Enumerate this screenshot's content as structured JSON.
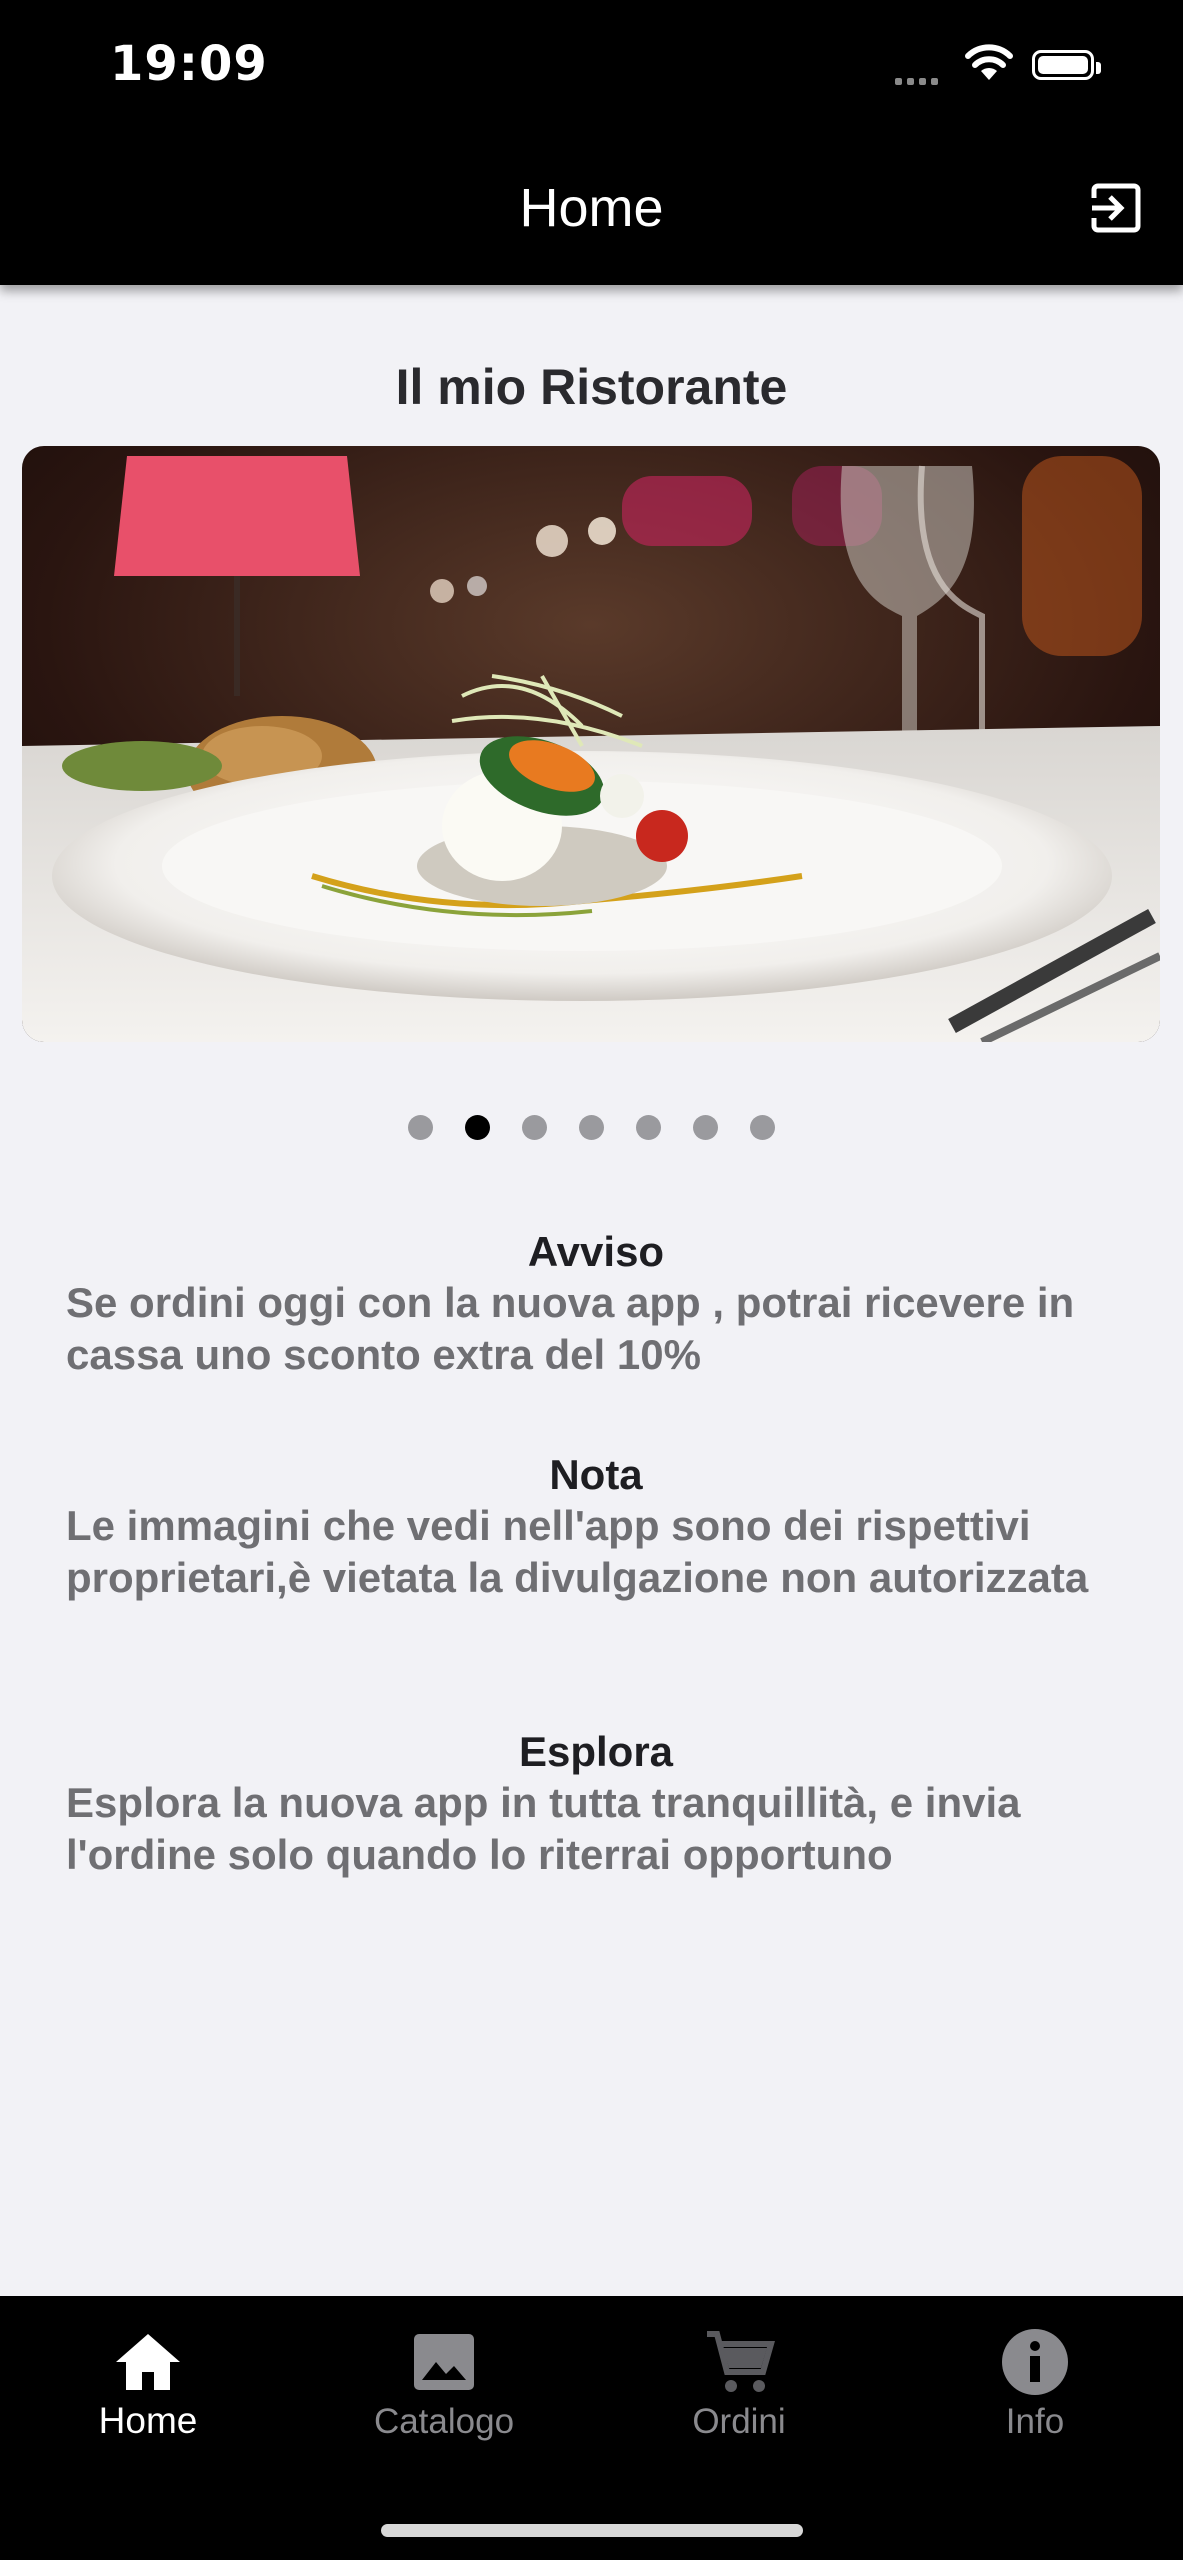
{
  "status_bar": {
    "time": "19:09"
  },
  "nav": {
    "title": "Home",
    "logout_icon": "logout-icon"
  },
  "restaurant": {
    "title": "Il mio Ristorante"
  },
  "carousel": {
    "slide_count": 7,
    "active_index": 1,
    "image": "restaurant-dish-photo"
  },
  "sections": [
    {
      "title": "Avviso",
      "text": "Se ordini oggi con la nuova app , potrai ricevere in cassa uno sconto extra del 10%"
    },
    {
      "title": "Nota",
      "text": "Le immagini che vedi nell'app sono dei rispettivi proprietari,è vietata la divulgazione non autorizzata"
    },
    {
      "title": "Esplora",
      "text": "Esplora la nuova app in tutta tranquillità, e invia l'ordine solo quando lo riterrai opportuno"
    }
  ],
  "tabs": [
    {
      "label": "Home",
      "icon": "home-icon",
      "active": true
    },
    {
      "label": "Catalogo",
      "icon": "image-icon",
      "active": false
    },
    {
      "label": "Ordini",
      "icon": "cart-icon",
      "active": false
    },
    {
      "label": "Info",
      "icon": "info-icon",
      "active": false
    }
  ],
  "colors": {
    "bar": "#000000",
    "background": "#f2f2f6",
    "inactive_tab": "#8a8a8e",
    "active_tab": "#ffffff"
  }
}
